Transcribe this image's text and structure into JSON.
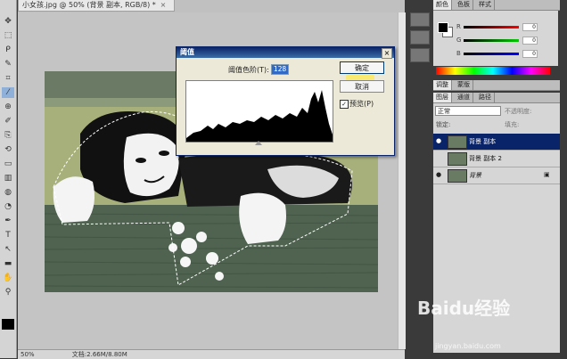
{
  "document": {
    "tab_title": "小女孩.jpg @ 50% (背景 副本, RGB/8) *",
    "close_glyph": "×",
    "zoom": "50%",
    "status": "文档:2.66M/8.80M"
  },
  "toolbar": {
    "tools": [
      "move-tool",
      "marquee-tool",
      "lasso-tool",
      "quick-select-tool",
      "crop-tool",
      "eyedropper-tool",
      "healing-tool",
      "brush-tool",
      "clone-tool",
      "history-brush-tool",
      "eraser-tool",
      "gradient-tool",
      "blur-tool",
      "dodge-tool",
      "pen-tool",
      "type-tool",
      "path-select-tool",
      "shape-tool",
      "hand-tool",
      "zoom-tool"
    ],
    "tool_glyphs": [
      "✥",
      "⬚",
      "ᑭ",
      "✎",
      "⌗",
      "⁄",
      "⊕",
      "✐",
      "⎘",
      "⟲",
      "▭",
      "▥",
      "◍",
      "◔",
      "✒",
      "T",
      "↖",
      "▬",
      "✋",
      "⚲"
    ]
  },
  "threshold_dialog": {
    "title": "阈值",
    "close_glyph": "×",
    "level_label": "阈值色阶(T):",
    "level_value": "128",
    "ok_label": "确定",
    "cancel_label": "取消",
    "preview_label": "预览(P)",
    "preview_checked": true,
    "preview_mark": "✓"
  },
  "color_panel": {
    "tabs": [
      "颜色",
      "色板",
      "样式"
    ],
    "channels": [
      {
        "label": "R",
        "value": "0"
      },
      {
        "label": "G",
        "value": "0"
      },
      {
        "label": "B",
        "value": "0"
      }
    ],
    "fg_color": "#000000",
    "bg_color": "#ffffff"
  },
  "adjust_panel": {
    "tabs": [
      "调整",
      "蒙版"
    ]
  },
  "layers_panel": {
    "tabs": [
      "图层",
      "通道",
      "路径"
    ],
    "blend_mode": "正常",
    "opacity_label": "不透明度:",
    "lock_label": "锁定:",
    "fill_label": "填充:",
    "layers": [
      {
        "name": "背景 副本",
        "selected": true,
        "visible": true
      },
      {
        "name": "背景 副本 2",
        "selected": false,
        "visible": false
      },
      {
        "name": "背景",
        "selected": false,
        "visible": true,
        "locked": true
      }
    ]
  },
  "watermark": {
    "text": "Baidu经验",
    "url": "jingyan.baidu.com"
  }
}
